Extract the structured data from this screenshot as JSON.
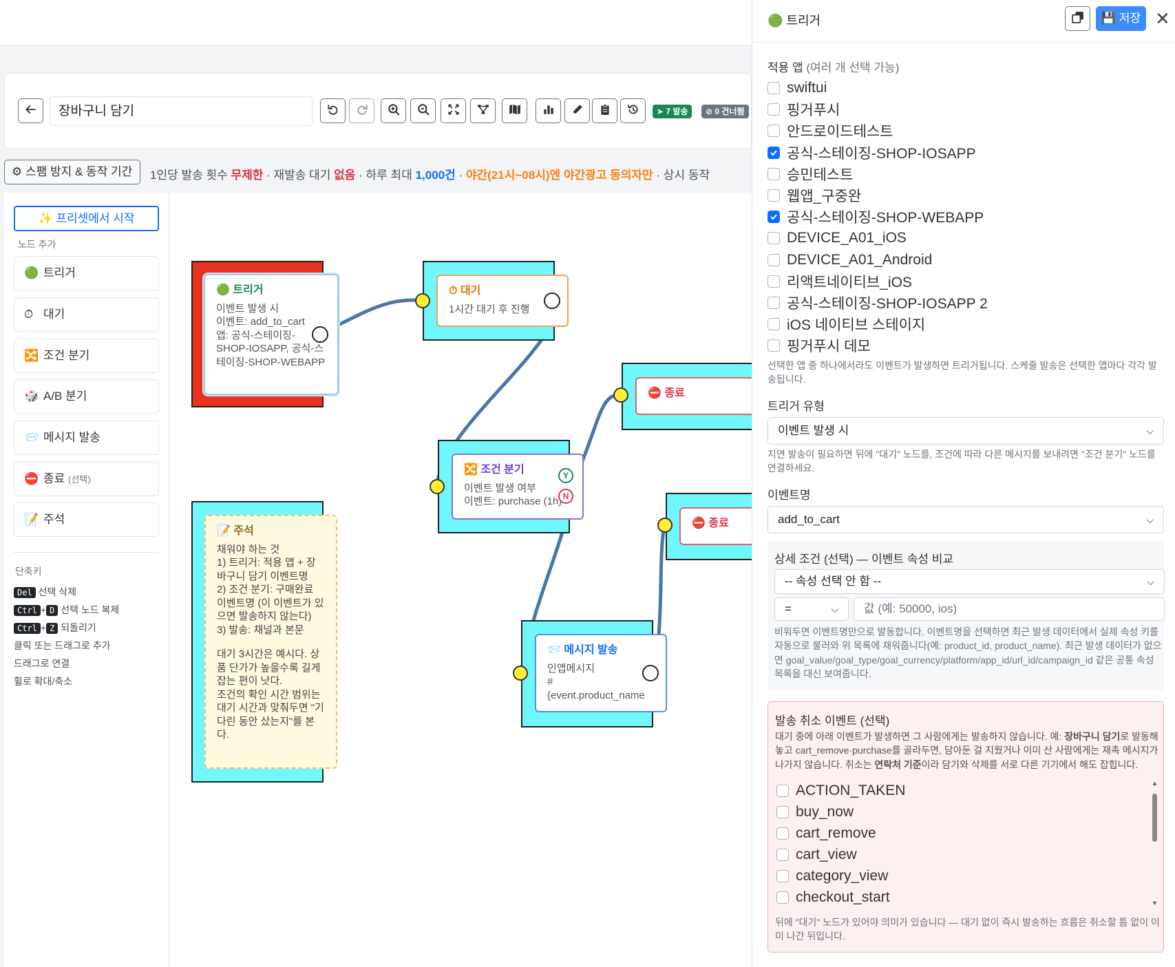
{
  "toolbar": {
    "title_value": "장바구니 담기",
    "badge_sent": "7 발송",
    "badge_skipped": "0 건너뜀"
  },
  "spam": {
    "button_label": "스팸 방지 & 동작 기간",
    "t1": "1인당 발송 횟수 ",
    "v1": "무제한",
    "t2": " · 재발송 대기 ",
    "v2": "없음",
    "t3": " · 하루 최대 ",
    "v3": "1,000건",
    "t4": " · ",
    "v4": "야간(21시~08시)엔 야간광고 동의자만",
    "t5": " · 상시 동작"
  },
  "palette": {
    "preset_button": "프리셋에서 시작",
    "section_label": "노드 추가",
    "items": [
      {
        "icon": "🟢",
        "label": "트리거",
        "sub": ""
      },
      {
        "icon": "⏱",
        "label": "대기",
        "sub": ""
      },
      {
        "icon": "🔀",
        "label": "조건 분기",
        "sub": ""
      },
      {
        "icon": "🎲",
        "label": "A/B 분기",
        "sub": ""
      },
      {
        "icon": "📨",
        "label": "메시지 발송",
        "sub": ""
      },
      {
        "icon": "⛔",
        "label": "종료",
        "sub": "(선택)"
      },
      {
        "icon": "📝",
        "label": "주석",
        "sub": ""
      }
    ],
    "shortcuts_title": "단축키",
    "shortcuts": {
      "del_key": "Del",
      "del_label": "선택 삭제",
      "ctrl": "Ctrl",
      "plus": "+",
      "d_key": "D",
      "dup_label": "선택 노드 복제",
      "z_key": "Z",
      "undo_label": "되돌리기",
      "click_add": "클릭 또는 드래그로 추가",
      "drag_connect": "드래그로 연결",
      "wheel_zoom": "휠로 확대/축소"
    }
  },
  "nodes": {
    "trigger": {
      "icon": "🟢",
      "title": "트리거",
      "l1": "이벤트 발생 시",
      "l2": "이벤트: add_to_cart",
      "l3": "앱: 공식-스테이징-SHOP-IOSAPP, 공식-스테이징-SHOP-WEBAPP"
    },
    "wait": {
      "icon": "⏱",
      "title": "대기",
      "l1": "1시간 대기 후 진행"
    },
    "end1": {
      "icon": "⛔",
      "title": "종료"
    },
    "end2": {
      "icon": "⛔",
      "title": "종료"
    },
    "cond": {
      "icon": "🔀",
      "title": "조건 분기",
      "l1": "이벤트 발생 여부",
      "l2": "이벤트: purchase (1h)",
      "yes": "Y",
      "no": "N"
    },
    "msg": {
      "icon": "📨",
      "title": "메시지 발송",
      "l1": "인앱메시지",
      "l2": "#",
      "l3": "{event.product_name"
    },
    "note": {
      "icon": "📝",
      "title": "주석",
      "l1": "채워야 하는 것",
      "l2": "1) 트리거: 적용 앱 + 장바구니 담기 이벤트명",
      "l3": "2) 조건 분기: 구매완료 이벤트명 (이 이벤트가 있으면 발송하지 않는다)",
      "l4": "3) 발송: 채널과 본문",
      "l5": "대기 3시간은 예시다. 상품 단가가 높을수록 길게 잡는 편이 낫다.",
      "l6": "조건의 확인 시간 범위는 대기 시간과 맞춰두면 \"기다린 동안 샀는지\"를 본다."
    }
  },
  "panel": {
    "title": "트리거",
    "save_label": "저장",
    "apps_label": "적용 앱",
    "apps_sub": "(여러 개 선택 가능)",
    "apps": [
      {
        "name": "swiftui",
        "checked": false
      },
      {
        "name": "핑거푸시",
        "checked": false
      },
      {
        "name": "안드로이드테스트",
        "checked": false
      },
      {
        "name": "공식-스테이징-SHOP-IOSAPP",
        "checked": true
      },
      {
        "name": "승민테스트",
        "checked": false
      },
      {
        "name": "웹앱_구중완",
        "checked": false
      },
      {
        "name": "공식-스테이징-SHOP-WEBAPP",
        "checked": true
      },
      {
        "name": "DEVICE_A01_iOS",
        "checked": false
      },
      {
        "name": "DEVICE_A01_Android",
        "checked": false
      },
      {
        "name": "리액트네이티브_iOS",
        "checked": false
      },
      {
        "name": "공식-스테이징-SHOP-IOSAPP 2",
        "checked": false
      },
      {
        "name": "iOS 네이티브 스테이지",
        "checked": false
      },
      {
        "name": "핑거푸시 데모",
        "checked": false
      }
    ],
    "apps_hint": "선택한 앱 중 하나에서라도 이벤트가 발생하면 트리거됩니다. 스케줄 발송은 선택한 앱마다 각각 발송됩니다.",
    "trigger_type_label": "트리거 유형",
    "trigger_type_value": "이벤트 발생 시",
    "trigger_type_hint": "지연 발송이 필요하면 뒤에 \"대기\" 노드를, 조건에 따라 다른 메시지를 보내려면 \"조건 분기\" 노드를 연결하세요.",
    "event_name_label": "이벤트명",
    "event_name_value": "add_to_cart",
    "detail_label": "상세 조건 (선택) — 이벤트 속성 비교",
    "prop_select": "-- 속성 선택 안 함 --",
    "op_select": "=",
    "value_placeholder": "값 (예: 50000, ios)",
    "detail_hint": "비워두면 이벤트명만으로 발동합니다. 이벤트명을 선택하면 최근 발생 데이터에서 실제 속성 키를 자동으로 불러와 위 목록에 채워줍니다(예: product_id, product_name). 최근 발생 데이터가 없으면 goal_value/goal_type/goal_currency/platform/app_id/url_id/campaign_id 같은 공통 속성 목록을 대신 보여줍니다.",
    "cancel_title": "발송 취소 이벤트 (선택)",
    "cancel_hint_a": "대기 중에 아래 이벤트가 발생하면 그 사람에게는 발송하지 않습니다. 예: ",
    "cancel_hint_b": "장바구니 담기",
    "cancel_hint_c": "로 발동해 놓고 cart_remove·purchase를 골라두면, 담아둔 걸 지웠거나 이미 산 사람에게는 재촉 메시지가 나가지 않습니다. 취소는 ",
    "cancel_hint_d": "연락처 기준",
    "cancel_hint_e": "이라 담기와 삭제를 서로 다른 기기에서 해도 잡힙니다.",
    "cancel_events": [
      "ACTION_TAKEN",
      "buy_now",
      "cart_remove",
      "cart_view",
      "category_view",
      "checkout_start"
    ],
    "cancel_footer": "뒤에 \"대기\" 노드가 있어야 의미가 있습니다 — 대기 없이 즉시 발송하는 흐름은 취소할 틈 없이 이미 나간 뒤입니다."
  },
  "colors": {
    "accent": "#0d6efd",
    "node_cyan": "#6ff7fb",
    "node_red": "#e8321e",
    "handle_yellow": "#ffee33",
    "edge": "#4a77a6"
  }
}
